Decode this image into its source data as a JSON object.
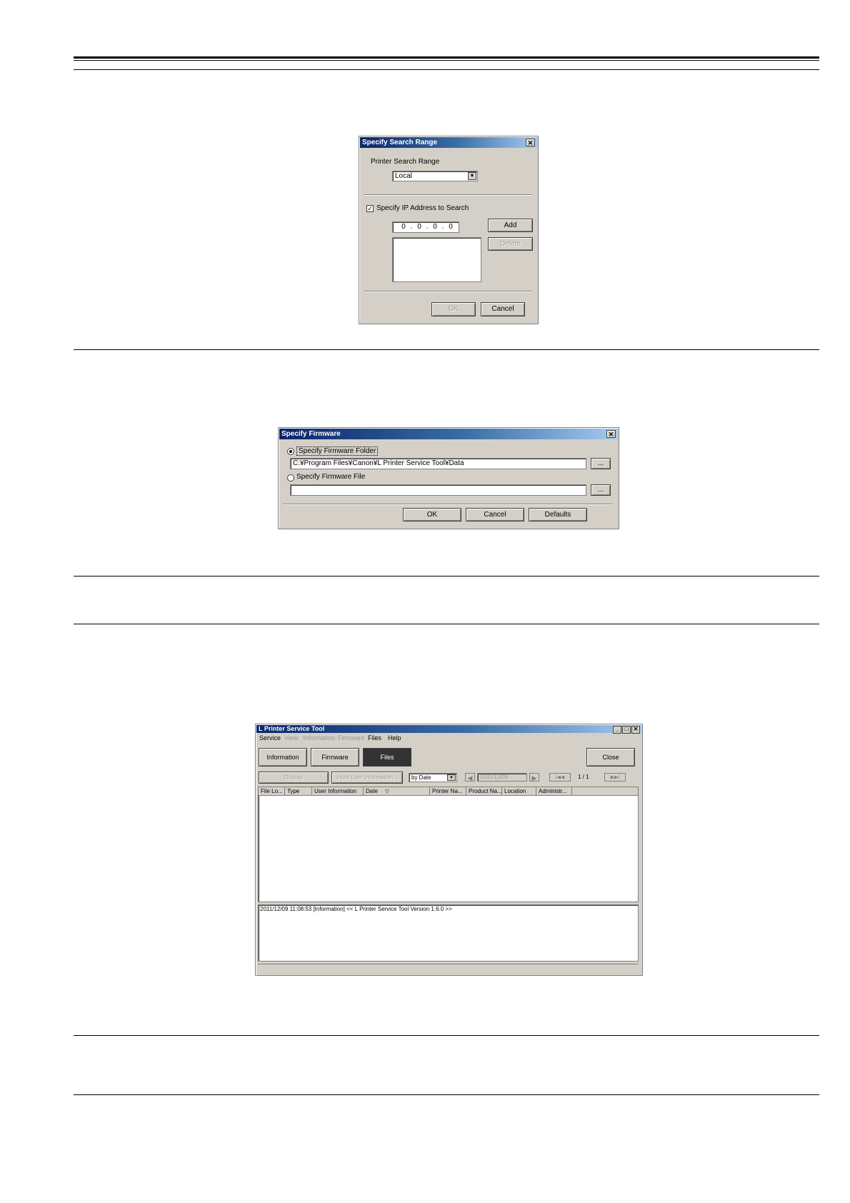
{
  "search_dialog": {
    "title": "Specify Search Range",
    "close_glyph": "✕",
    "range_label": "Printer Search Range",
    "range_value": "Local",
    "dropdown_glyph": "▼",
    "ip_checkbox_label": "Specify IP Address to Search",
    "ip_checkbox_checked": true,
    "check_glyph": "✓",
    "ip_octets": [
      "0",
      "0",
      "0",
      "0"
    ],
    "ip_dot": ".",
    "add_label": "Add",
    "delete_label": "Delete",
    "ok_label": "OK",
    "cancel_label": "Cancel"
  },
  "firmware_dialog": {
    "title": "Specify Firmware",
    "close_glyph": "✕",
    "folder_radio_label": "Specify Firmware Folder",
    "folder_path": "C:¥Program Files¥Canon¥L Printer Service Tool¥Data",
    "browse_label": "...",
    "file_radio_label": "Specify Firmware File",
    "file_path": "",
    "ok_label": "OK",
    "cancel_label": "Cancel",
    "defaults_label": "Defaults"
  },
  "service_tool": {
    "title": "L Printer Service Tool",
    "window_controls": [
      "_",
      "□",
      "✕"
    ],
    "menu": [
      "Service",
      "View",
      "Information",
      "Firmware",
      "Files",
      "Help"
    ],
    "tabs": [
      "Information",
      "Firmware",
      "Files"
    ],
    "close_label": "Close",
    "display_label": "Display",
    "input_user_info_label": "Input User Information...",
    "sort_value": "by Date",
    "dropdown_glyph": "▼",
    "date_value": "2011/12/09",
    "nav_prev": "◀",
    "nav_next": "▶",
    "nav_first": "|◀◀",
    "nav_last": "▶▶|",
    "page_indicator": "1 / 1",
    "columns": [
      "File Lo...",
      "Type",
      "User Information",
      "Date",
      "Printer Na...",
      "Product Na...",
      "Location",
      "Administr..."
    ],
    "sort_indicator": "▽",
    "log_line": "2011/12/09 11:08:53 [Information]   << L Printer Service Tool  Version 1.6.0 >>"
  }
}
